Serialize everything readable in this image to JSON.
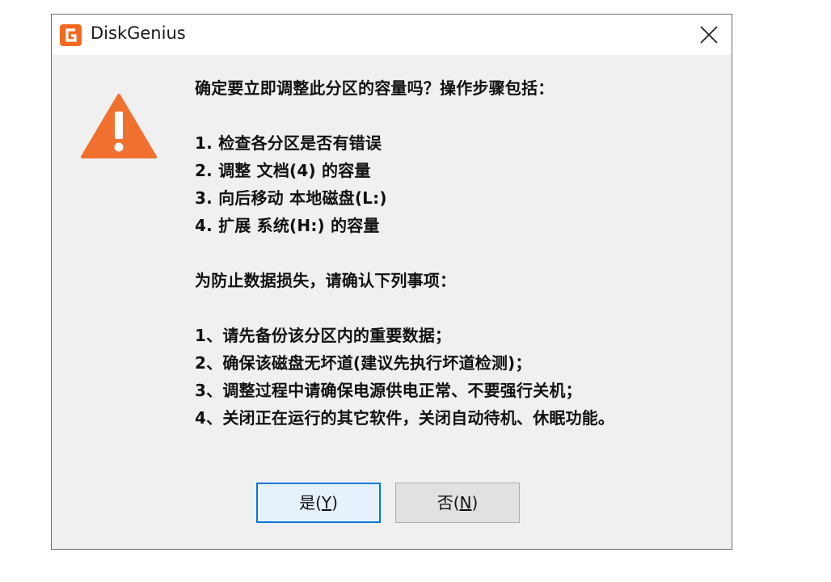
{
  "window": {
    "title": "DiskGenius",
    "app_icon": "diskgenius-logo-icon",
    "close_icon": "close-icon",
    "accent_color": "#f26a21"
  },
  "message": {
    "icon": "warning-icon",
    "question": "确定要立即调整此分区的容量吗？操作步骤包括：",
    "steps": [
      "1. 检查各分区是否有错误",
      "2. 调整 文档(4) 的容量",
      "3. 向后移动 本地磁盘(L:)",
      "4. 扩展 系统(H:) 的容量"
    ],
    "notice_heading": "为防止数据损失，请确认下列事项：",
    "notices": [
      "1、请先备份该分区内的重要数据；",
      "2、确保该磁盘无坏道(建议先执行坏道检测)；",
      "3、调整过程中请确保电源供电正常、不要强行关机；",
      "4、关闭正在运行的其它软件，关闭自动待机、休眠功能。"
    ]
  },
  "buttons": {
    "yes_label": "是(",
    "yes_mnemonic": "Y",
    "yes_suffix": ")",
    "no_label": "否(",
    "no_mnemonic": "N",
    "no_suffix": ")"
  }
}
